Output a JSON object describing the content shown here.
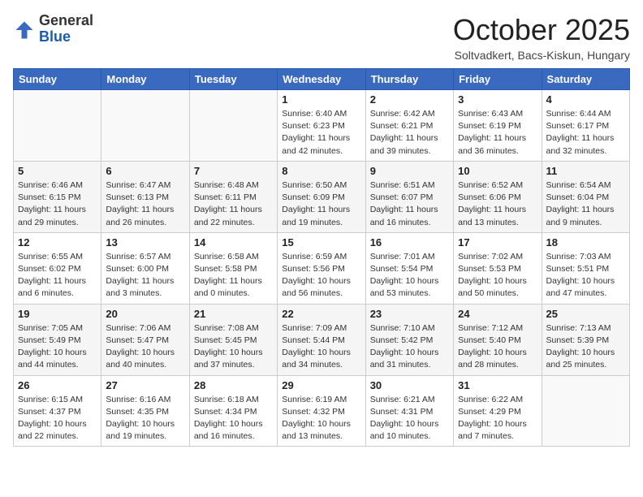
{
  "header": {
    "logo": {
      "general": "General",
      "blue": "Blue"
    },
    "title": "October 2025",
    "location": "Soltvadkert, Bacs-Kiskun, Hungary"
  },
  "weekdays": [
    "Sunday",
    "Monday",
    "Tuesday",
    "Wednesday",
    "Thursday",
    "Friday",
    "Saturday"
  ],
  "weeks": [
    [
      {
        "day": "",
        "info": ""
      },
      {
        "day": "",
        "info": ""
      },
      {
        "day": "",
        "info": ""
      },
      {
        "day": "1",
        "info": "Sunrise: 6:40 AM\nSunset: 6:23 PM\nDaylight: 11 hours and 42 minutes."
      },
      {
        "day": "2",
        "info": "Sunrise: 6:42 AM\nSunset: 6:21 PM\nDaylight: 11 hours and 39 minutes."
      },
      {
        "day": "3",
        "info": "Sunrise: 6:43 AM\nSunset: 6:19 PM\nDaylight: 11 hours and 36 minutes."
      },
      {
        "day": "4",
        "info": "Sunrise: 6:44 AM\nSunset: 6:17 PM\nDaylight: 11 hours and 32 minutes."
      }
    ],
    [
      {
        "day": "5",
        "info": "Sunrise: 6:46 AM\nSunset: 6:15 PM\nDaylight: 11 hours and 29 minutes."
      },
      {
        "day": "6",
        "info": "Sunrise: 6:47 AM\nSunset: 6:13 PM\nDaylight: 11 hours and 26 minutes."
      },
      {
        "day": "7",
        "info": "Sunrise: 6:48 AM\nSunset: 6:11 PM\nDaylight: 11 hours and 22 minutes."
      },
      {
        "day": "8",
        "info": "Sunrise: 6:50 AM\nSunset: 6:09 PM\nDaylight: 11 hours and 19 minutes."
      },
      {
        "day": "9",
        "info": "Sunrise: 6:51 AM\nSunset: 6:07 PM\nDaylight: 11 hours and 16 minutes."
      },
      {
        "day": "10",
        "info": "Sunrise: 6:52 AM\nSunset: 6:06 PM\nDaylight: 11 hours and 13 minutes."
      },
      {
        "day": "11",
        "info": "Sunrise: 6:54 AM\nSunset: 6:04 PM\nDaylight: 11 hours and 9 minutes."
      }
    ],
    [
      {
        "day": "12",
        "info": "Sunrise: 6:55 AM\nSunset: 6:02 PM\nDaylight: 11 hours and 6 minutes."
      },
      {
        "day": "13",
        "info": "Sunrise: 6:57 AM\nSunset: 6:00 PM\nDaylight: 11 hours and 3 minutes."
      },
      {
        "day": "14",
        "info": "Sunrise: 6:58 AM\nSunset: 5:58 PM\nDaylight: 11 hours and 0 minutes."
      },
      {
        "day": "15",
        "info": "Sunrise: 6:59 AM\nSunset: 5:56 PM\nDaylight: 10 hours and 56 minutes."
      },
      {
        "day": "16",
        "info": "Sunrise: 7:01 AM\nSunset: 5:54 PM\nDaylight: 10 hours and 53 minutes."
      },
      {
        "day": "17",
        "info": "Sunrise: 7:02 AM\nSunset: 5:53 PM\nDaylight: 10 hours and 50 minutes."
      },
      {
        "day": "18",
        "info": "Sunrise: 7:03 AM\nSunset: 5:51 PM\nDaylight: 10 hours and 47 minutes."
      }
    ],
    [
      {
        "day": "19",
        "info": "Sunrise: 7:05 AM\nSunset: 5:49 PM\nDaylight: 10 hours and 44 minutes."
      },
      {
        "day": "20",
        "info": "Sunrise: 7:06 AM\nSunset: 5:47 PM\nDaylight: 10 hours and 40 minutes."
      },
      {
        "day": "21",
        "info": "Sunrise: 7:08 AM\nSunset: 5:45 PM\nDaylight: 10 hours and 37 minutes."
      },
      {
        "day": "22",
        "info": "Sunrise: 7:09 AM\nSunset: 5:44 PM\nDaylight: 10 hours and 34 minutes."
      },
      {
        "day": "23",
        "info": "Sunrise: 7:10 AM\nSunset: 5:42 PM\nDaylight: 10 hours and 31 minutes."
      },
      {
        "day": "24",
        "info": "Sunrise: 7:12 AM\nSunset: 5:40 PM\nDaylight: 10 hours and 28 minutes."
      },
      {
        "day": "25",
        "info": "Sunrise: 7:13 AM\nSunset: 5:39 PM\nDaylight: 10 hours and 25 minutes."
      }
    ],
    [
      {
        "day": "26",
        "info": "Sunrise: 6:15 AM\nSunset: 4:37 PM\nDaylight: 10 hours and 22 minutes."
      },
      {
        "day": "27",
        "info": "Sunrise: 6:16 AM\nSunset: 4:35 PM\nDaylight: 10 hours and 19 minutes."
      },
      {
        "day": "28",
        "info": "Sunrise: 6:18 AM\nSunset: 4:34 PM\nDaylight: 10 hours and 16 minutes."
      },
      {
        "day": "29",
        "info": "Sunrise: 6:19 AM\nSunset: 4:32 PM\nDaylight: 10 hours and 13 minutes."
      },
      {
        "day": "30",
        "info": "Sunrise: 6:21 AM\nSunset: 4:31 PM\nDaylight: 10 hours and 10 minutes."
      },
      {
        "day": "31",
        "info": "Sunrise: 6:22 AM\nSunset: 4:29 PM\nDaylight: 10 hours and 7 minutes."
      },
      {
        "day": "",
        "info": ""
      }
    ]
  ]
}
